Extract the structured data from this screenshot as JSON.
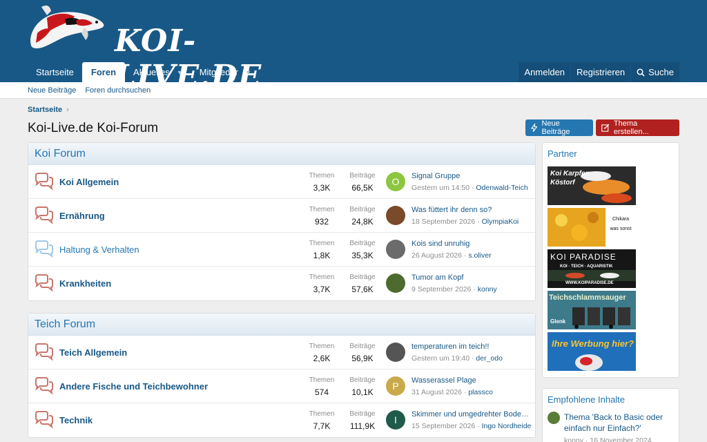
{
  "brand": {
    "logo_text": "KOI-LIVE.DE"
  },
  "nav": {
    "items": [
      {
        "label": "Startseite",
        "active": false,
        "caret": false
      },
      {
        "label": "Foren",
        "active": true,
        "caret": false
      },
      {
        "label": "Aktuelles",
        "active": false,
        "caret": true
      },
      {
        "label": "Mitglieder",
        "active": false,
        "caret": true
      }
    ],
    "login": "Anmelden",
    "register": "Registrieren",
    "search": "Suche"
  },
  "subnav": {
    "new_posts": "Neue Beiträge",
    "search_forums": "Foren durchsuchen"
  },
  "breadcrumb": {
    "home": "Startseite"
  },
  "page": {
    "title": "Koi-Live.de Koi-Forum",
    "new_posts_button": "Neue Beiträge",
    "create_thread_button": "Thema erstellen..."
  },
  "labels": {
    "threads": "Themen",
    "posts": "Beiträge"
  },
  "colors": {
    "header": "#185886",
    "accent": "#2577b1",
    "create": "#b0211f"
  },
  "categories": [
    {
      "title": "Koi Forum",
      "forums": [
        {
          "name": "Koi Allgemein",
          "unread": true,
          "threads": "3,3K",
          "posts": "66,5K",
          "last_title": "Signal Gruppe",
          "last_date": "Gestern um 14:50",
          "last_user": "Odenwald-Teich",
          "avatar_letter": "O",
          "avatar_color": "#8dc63f"
        },
        {
          "name": "Ernährung",
          "unread": true,
          "threads": "932",
          "posts": "24,8K",
          "last_title": "Was füttert ihr denn so?",
          "last_date": "18 September 2026",
          "last_user": "OlympiaKoi",
          "avatar_letter": "",
          "avatar_color": "#7a4a2a"
        },
        {
          "name": "Haltung & Verhalten",
          "unread": false,
          "threads": "1,8K",
          "posts": "35,3K",
          "last_title": "Kois sind unruhig",
          "last_date": "26 August 2026",
          "last_user": "s.oliver",
          "avatar_letter": "",
          "avatar_color": "#6b6b6b"
        },
        {
          "name": "Krankheiten",
          "unread": true,
          "threads": "3,7K",
          "posts": "57,6K",
          "last_title": "Tumor am Kopf",
          "last_date": "9 September 2026",
          "last_user": "konny",
          "avatar_letter": "",
          "avatar_color": "#4d6b2e"
        }
      ]
    },
    {
      "title": "Teich Forum",
      "forums": [
        {
          "name": "Teich Allgemein",
          "unread": true,
          "threads": "2,6K",
          "posts": "56,9K",
          "last_title": "temperaturen im teich!!",
          "last_date": "Gestern um 19:40",
          "last_user": "der_odo",
          "avatar_letter": "",
          "avatar_color": "#555555"
        },
        {
          "name": "Andere Fische und Teichbewohner",
          "unread": true,
          "threads": "574",
          "posts": "10,1K",
          "last_title": "Wasserassel Plage",
          "last_date": "31 August 2026",
          "last_user": "plassco",
          "avatar_letter": "P",
          "avatar_color": "#c9a94a"
        },
        {
          "name": "Technik",
          "unread": true,
          "threads": "7,7K",
          "posts": "111,9K",
          "last_title": "Skimmer und umgedrehter Boden…",
          "last_date": "15 September 2026",
          "last_user": "Ingo Nordheide",
          "avatar_letter": "I",
          "avatar_color": "#1f5b4a"
        }
      ]
    }
  ],
  "sidebar": {
    "partner_title": "Partner",
    "banners": [
      {
        "text": "Koi Karpfen Köstorf",
        "bg": "#222222"
      },
      {
        "text": "Chikara was sonst",
        "bg": "#e0a020"
      },
      {
        "text": "KOI PARADISE",
        "sub": "KOI · TEICH · AQUARISTIK",
        "url": "WWW.KOIPARADISE.DE",
        "bg": "#1a1a1a"
      },
      {
        "text": "Teichschlammsauger",
        "sub": "Glenk",
        "bg": "#3d7a8a"
      },
      {
        "text": "Ihre Werbung hier?",
        "bg": "#1e6fb8"
      }
    ],
    "featured_title": "Empfohlene Inhalte",
    "featured_thread": "Thema 'Back to Basic oder einfach nur Einfach?'",
    "featured_meta": "konny · 16 November 2024"
  }
}
